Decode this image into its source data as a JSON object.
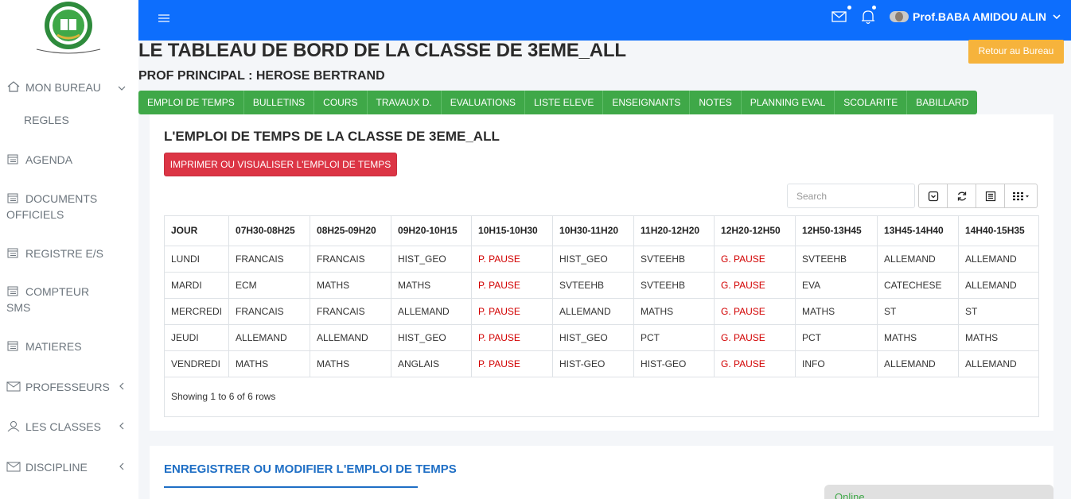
{
  "app": {
    "user_name": "Prof.BABA AMIDOU ALIN",
    "logo_alt": "school-logo"
  },
  "sidebar": {
    "items": [
      {
        "label": "MON BUREAU",
        "icon": "home-icon",
        "has_chevron": "down"
      },
      {
        "label": "REGLES",
        "icon": "",
        "has_chevron": ""
      },
      {
        "label": "AGENDA",
        "icon": "calendar-icon",
        "has_chevron": ""
      },
      {
        "label": "DOCUMENTS",
        "label2": "OFFICIELS",
        "icon": "calendar-icon",
        "has_chevron": ""
      },
      {
        "label": "REGISTRE E/S",
        "icon": "calendar-icon",
        "has_chevron": ""
      },
      {
        "label": "COMPTEUR",
        "label2": "SMS",
        "icon": "calendar-icon",
        "has_chevron": ""
      },
      {
        "label": "MATIERES",
        "icon": "calendar-icon",
        "has_chevron": ""
      },
      {
        "label": "PROFESSEURS",
        "icon": "envelope-icon",
        "has_chevron": "left"
      },
      {
        "label": "LES CLASSES",
        "icon": "user-icon",
        "has_chevron": "left"
      },
      {
        "label": "DISCIPLINE",
        "icon": "envelope-icon",
        "has_chevron": "left"
      }
    ]
  },
  "header": {
    "title": "LE TABLEAU DE BORD DE LA CLASSE DE 3EME_ALL",
    "subtitle": "PROF PRINCIPAL : HEROSE BERTRAND",
    "retour_label": "Retour au Bureau"
  },
  "tabs": [
    "EMPLOI DE TEMPS",
    "BULLETINS",
    "COURS",
    "TRAVAUX D.",
    "EVALUATIONS",
    "LISTE ELEVE",
    "ENSEIGNANTS",
    "NOTES",
    "PLANNING EVAL",
    "SCOLARITE",
    "BABILLARD"
  ],
  "timetable": {
    "title": "L'EMPLOI DE TEMPS DE LA CLASSE DE 3EME_ALL",
    "print_label": "IMPRIMER OU VISUALISER L'EMPLOI DE TEMPS",
    "search_placeholder": "Search",
    "columns": [
      "JOUR",
      "07H30-08H25",
      "08H25-09H20",
      "09H20-10H15",
      "10H15-10H30",
      "10H30-11H20",
      "11H20-12H20",
      "12H20-12H50",
      "12H50-13H45",
      "13H45-14H40",
      "14H40-15H35"
    ],
    "rows": [
      [
        "LUNDI",
        "FRANCAIS",
        "FRANCAIS",
        "HIST_GEO",
        "P. PAUSE",
        "HIST_GEO",
        "SVTEEHB",
        "G. PAUSE",
        "SVTEEHB",
        "ALLEMAND",
        "ALLEMAND"
      ],
      [
        "MARDI",
        "ECM",
        "MATHS",
        "MATHS",
        "P. PAUSE",
        "SVTEEHB",
        "SVTEEHB",
        "G. PAUSE",
        "EVA",
        "CATECHESE",
        "ALLEMAND"
      ],
      [
        "MERCREDI",
        "FRANCAIS",
        "FRANCAIS",
        "ALLEMAND",
        "P. PAUSE",
        "ALLEMAND",
        "MATHS",
        "G. PAUSE",
        "MATHS",
        "ST",
        "ST"
      ],
      [
        "JEUDI",
        "ALLEMAND",
        "ALLEMAND",
        "HIST_GEO",
        "P. PAUSE",
        "HIST_GEO",
        "PCT",
        "G. PAUSE",
        "PCT",
        "MATHS",
        "MATHS"
      ],
      [
        "VENDREDI",
        "MATHS",
        "MATHS",
        "ANGLAIS",
        "P. PAUSE",
        "HIST-GEO",
        "HIST-GEO",
        "G. PAUSE",
        "INFO",
        "ALLEMAND",
        "ALLEMAND"
      ]
    ],
    "showing": "Showing 1 to 6 of 6 rows",
    "pause_color": "#d20000"
  },
  "edit_section": {
    "title": "ENREGISTRER OU MODIFIER L'EMPLOI DE TEMPS"
  },
  "status": {
    "online": "Online"
  },
  "colors": {
    "topbar": "#0d6efd",
    "tabs": "#3fa848",
    "retour": "#f6b33c",
    "print": "#dc3545"
  }
}
